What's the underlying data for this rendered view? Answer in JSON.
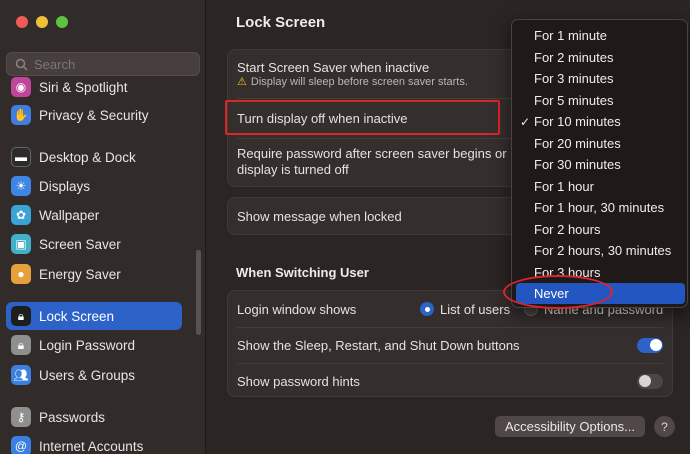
{
  "window": {
    "title": "Lock Screen"
  },
  "search": {
    "placeholder": "Search"
  },
  "sidebar": {
    "items": [
      {
        "label": "Siri & Spotlight",
        "icon": "siri-icon",
        "color": "#c1459a"
      },
      {
        "label": "Privacy & Security",
        "icon": "hand-icon",
        "color": "#3f7de0"
      },
      {
        "label": "Desktop & Dock",
        "icon": "dock-icon",
        "color": "#2b2b2b"
      },
      {
        "label": "Displays",
        "icon": "sun-icon",
        "color": "#3d86e6"
      },
      {
        "label": "Wallpaper",
        "icon": "flower-icon",
        "color": "#3ba3d6"
      },
      {
        "label": "Screen Saver",
        "icon": "screensaver-icon",
        "color": "#42b0c6"
      },
      {
        "label": "Energy Saver",
        "icon": "bulb-icon",
        "color": "#e8a13a"
      },
      {
        "label": "Lock Screen",
        "icon": "lock-icon",
        "color": "#1e1e1e",
        "active": true
      },
      {
        "label": "Login Password",
        "icon": "padlock-icon",
        "color": "#8f8f8f"
      },
      {
        "label": "Users & Groups",
        "icon": "users-icon",
        "color": "#3b7fe0"
      },
      {
        "label": "Passwords",
        "icon": "key-icon",
        "color": "#8f8f8f"
      },
      {
        "label": "Internet Accounts",
        "icon": "at-icon",
        "color": "#3b7fe0"
      }
    ]
  },
  "main": {
    "title": "Lock Screen",
    "group1": {
      "screen_saver_label": "Start Screen Saver when inactive",
      "screen_saver_warning": "Display will sleep before screen saver starts.",
      "display_off_label": "Turn display off when inactive",
      "require_password_label_1": "Require password after screen saver begins or",
      "require_password_label_2": "display is turned off"
    },
    "group2": {
      "show_message_label": "Show message when locked"
    },
    "switching_user": {
      "title": "When Switching User",
      "login_window_label": "Login window shows",
      "option_list": "List of users",
      "option_name": "Name and password",
      "sleep_buttons_label": "Show the Sleep, Restart, and Shut Down buttons",
      "sleep_buttons_on": true,
      "password_hints_label": "Show password hints",
      "password_hints_on": false
    },
    "accessibility_button": "Accessibility Options...",
    "help_button": "?"
  },
  "menu": {
    "items": [
      "For 1 minute",
      "For 2 minutes",
      "For 3 minutes",
      "For 5 minutes",
      "For 10 minutes",
      "For 20 minutes",
      "For 30 minutes",
      "For 1 hour",
      "For 1 hour, 30 minutes",
      "For 2 hours",
      "For 2 hours, 30 minutes",
      "For 3 hours",
      "Never"
    ],
    "checked": "For 10 minutes",
    "highlighted": "Never",
    "check_mark": "✓"
  },
  "colors": {
    "accent": "#2d62c9",
    "annotation": "#d8262a"
  }
}
